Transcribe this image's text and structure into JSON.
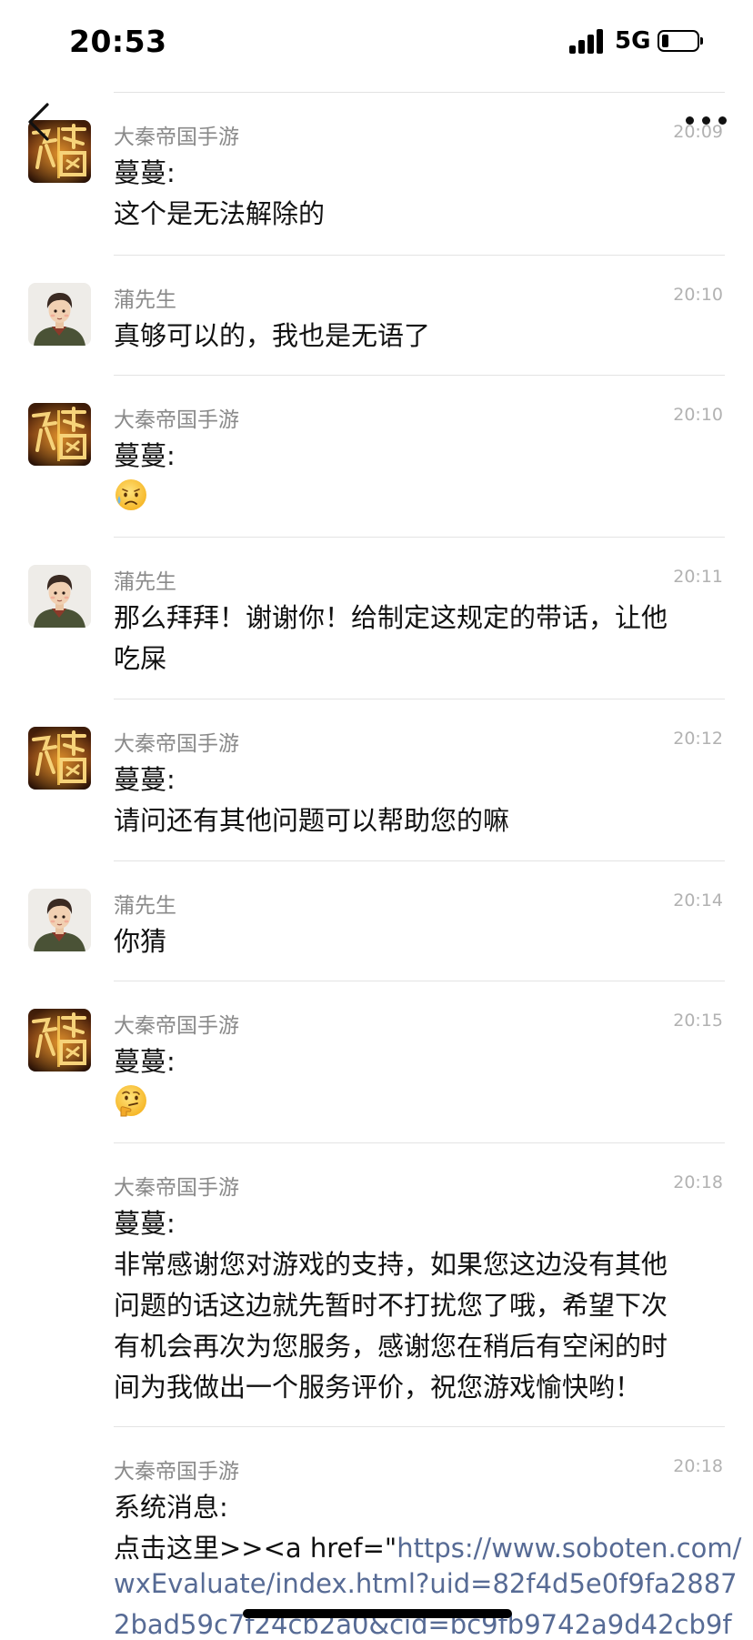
{
  "status_bar": {
    "time": "20:53",
    "network": "5G"
  },
  "messages": [
    {
      "sender": "大秦帝国手游",
      "time": "20:09",
      "avatar": "game-logo",
      "lines": [
        "蔓蔓:",
        "这个是无法解除的"
      ]
    },
    {
      "sender": "蒲先生",
      "time": "20:10",
      "avatar": "user-avatar",
      "lines": [
        "真够可以的，我也是无语了"
      ]
    },
    {
      "sender": "大秦帝国手游",
      "time": "20:10",
      "avatar": "game-logo",
      "lines": [
        "蔓蔓:"
      ],
      "emoji": "sad-sweat-emoji"
    },
    {
      "sender": "蒲先生",
      "time": "20:11",
      "avatar": "user-avatar",
      "lines": [
        "那么拜拜！谢谢你！给制定这规定的带话，让他",
        "吃屎"
      ]
    },
    {
      "sender": "大秦帝国手游",
      "time": "20:12",
      "avatar": "game-logo",
      "lines": [
        "蔓蔓:",
        "请问还有其他问题可以帮助您的嘛"
      ]
    },
    {
      "sender": "蒲先生",
      "time": "20:14",
      "avatar": "user-avatar",
      "lines": [
        "你猜"
      ]
    },
    {
      "sender": "大秦帝国手游",
      "time": "20:15",
      "avatar": "game-logo",
      "lines": [
        "蔓蔓:"
      ],
      "emoji": "thinking-face-emoji"
    },
    {
      "sender": "大秦帝国手游",
      "time": "20:18",
      "lines": [
        "蔓蔓:",
        "非常感谢您对游戏的支持，如果您这边没有其他",
        "问题的话这边就先暂时不打扰您了哦，希望下次",
        "有机会再次为您服务，感谢您在稍后有空闲的时",
        "间为我做出一个服务评价，祝您游戏愉快哟！"
      ]
    },
    {
      "sender": "大秦帝国手游",
      "time": "20:18",
      "lines": [
        "系统消息:"
      ],
      "link_prefix": "点击这里>><a href=\"",
      "link_lines": [
        "https://www.soboten.com/",
        "wxEvaluate/index.html?uid=82f4d5e0f9fa2887",
        "2bad59c7f24cb2a0&cid=bc9fb9742a9d42cb9f"
      ]
    }
  ],
  "icons": {
    "back": "back-chevron-icon",
    "more": "more-dots-icon",
    "signal": "signal-bars-icon",
    "battery": "battery-icon"
  },
  "colors": {
    "link": "#576b95",
    "sender": "#8a8a8a",
    "timestamp": "#b2b2b2",
    "divider": "#e3e3e3"
  }
}
